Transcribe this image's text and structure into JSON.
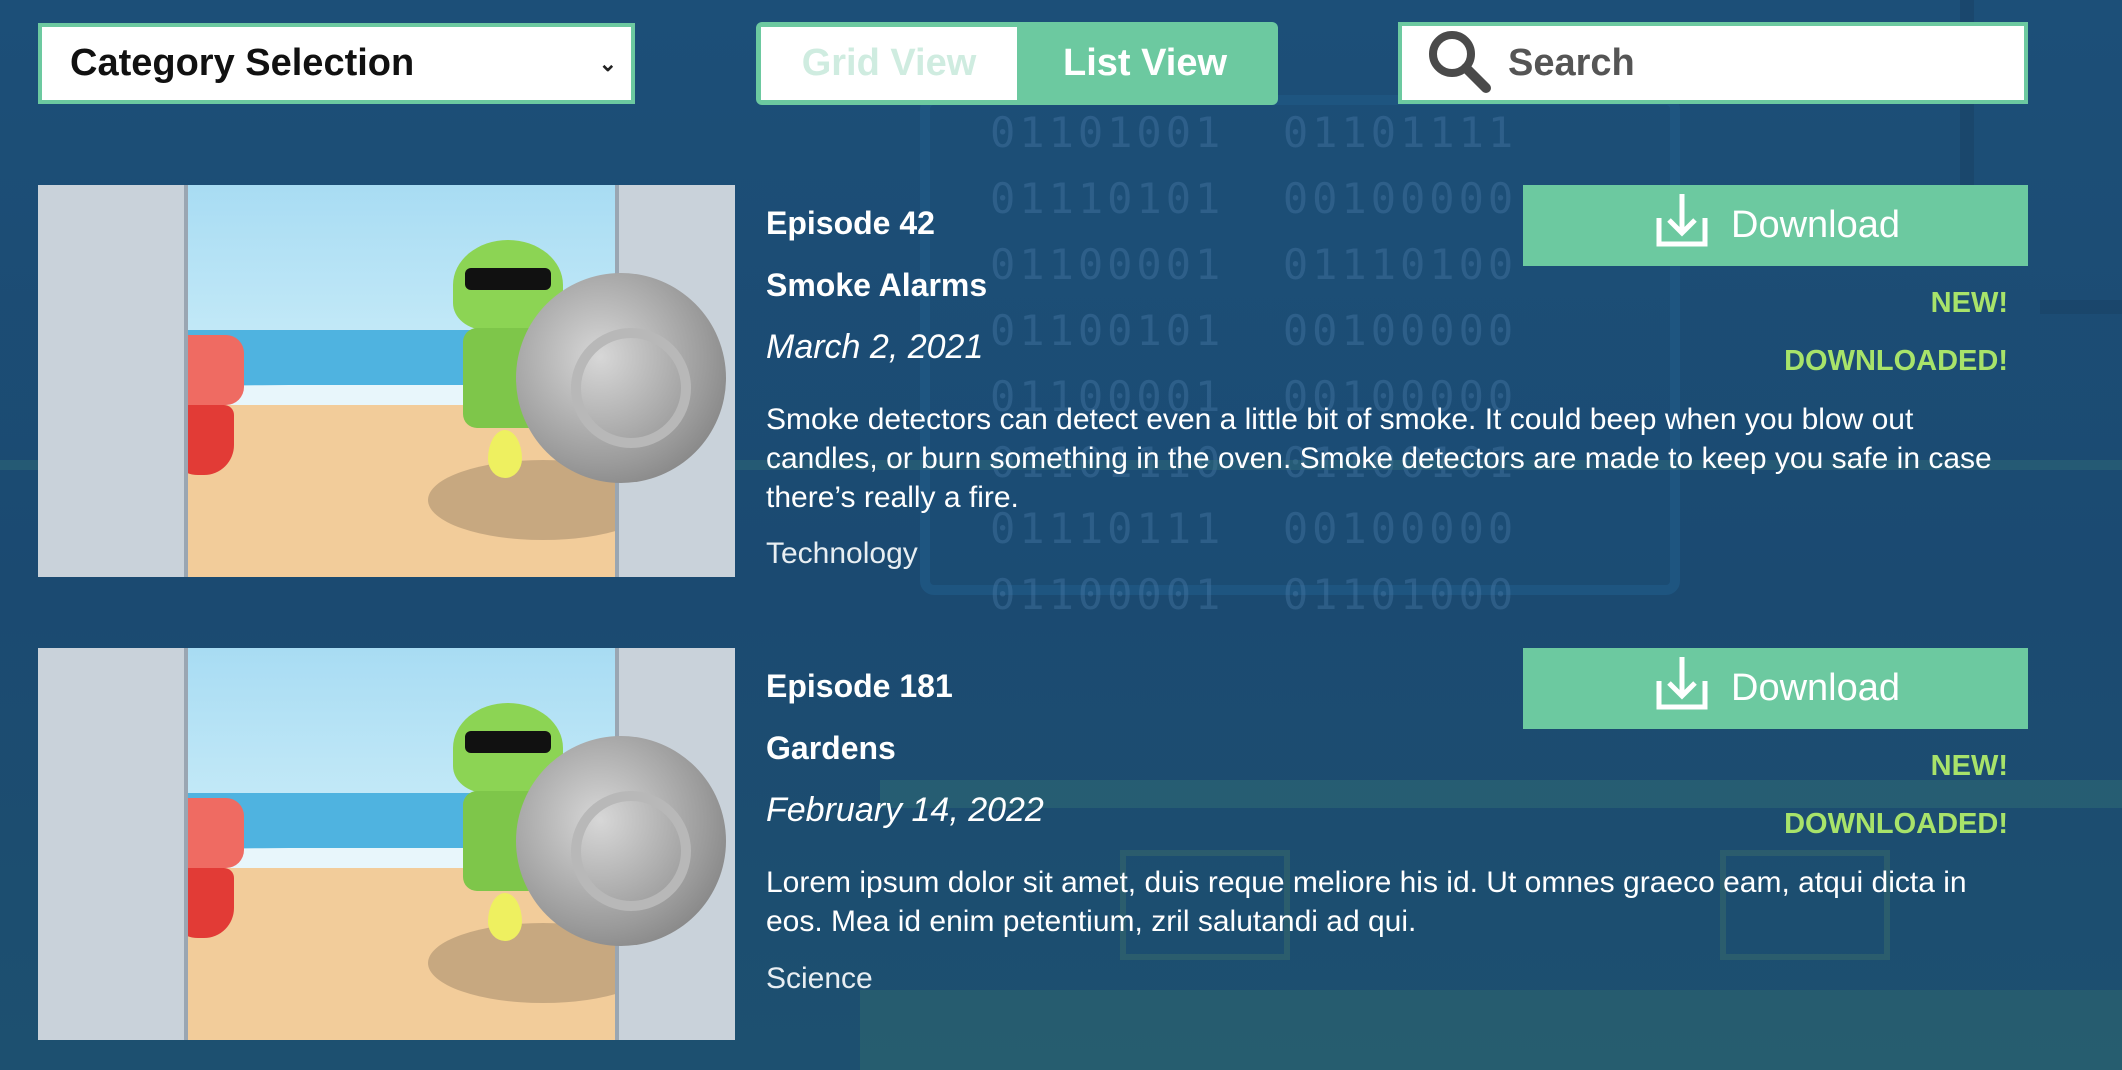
{
  "toolbar": {
    "category_label": "Category Selection",
    "view_toggle": {
      "grid_label": "Grid View",
      "list_label": "List View",
      "selected": "list"
    },
    "search_placeholder": "Search"
  },
  "episodes": [
    {
      "episode": "Episode 42",
      "title": "Smoke Alarms",
      "date": "March 2, 2021",
      "description": "Smoke detectors can detect even a little bit of smoke. It could beep when you blow out candles, or burn something in the oven. Smoke detectors are made to keep you safe in case there’s really a fire.",
      "category": "Technology",
      "download_label": "Download",
      "new_label": "NEW!",
      "downloaded_label": "DOWNLOADED!"
    },
    {
      "episode": "Episode 181",
      "title": "Gardens",
      "date": "February 14, 2022",
      "description": "Lorem ipsum dolor sit amet, duis reque meliore his id. Ut omnes graeco eam, atqui dicta in eos. Mea id enim petentium, zril salutandi ad qui.",
      "category": "Science",
      "download_label": "Download",
      "new_label": "NEW!",
      "downloaded_label": "DOWNLOADED!"
    }
  ],
  "colors": {
    "accent": "#6cc9a0",
    "badge": "#a8e36a",
    "background": "#1b4a72"
  },
  "icons": {
    "search": "search-icon",
    "download": "download-icon",
    "dropdown": "chevron-down-icon"
  }
}
